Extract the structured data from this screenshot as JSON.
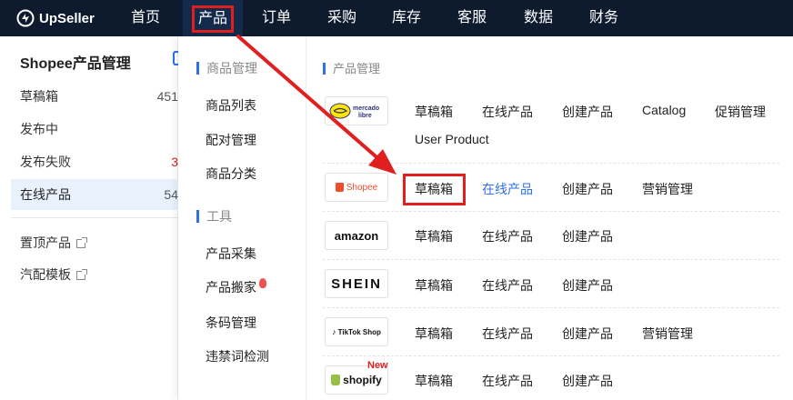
{
  "brand": {
    "name": "UpSeller"
  },
  "topnav": {
    "items": [
      "首页",
      "产品",
      "订单",
      "采购",
      "库存",
      "客服",
      "数据",
      "财务"
    ],
    "active_index": 1
  },
  "sidebar": {
    "title": "Shopee产品管理",
    "items": [
      {
        "label": "草稿箱",
        "count": "451"
      },
      {
        "label": "发布中",
        "count": ""
      },
      {
        "label": "发布失败",
        "count": "3"
      },
      {
        "label": "在线产品",
        "count": "54"
      }
    ],
    "links": [
      {
        "label": "置顶产品"
      },
      {
        "label": "汽配模板"
      }
    ]
  },
  "dropdown": {
    "sections": [
      {
        "title": "商品管理",
        "items": [
          "商品列表",
          "配对管理",
          "商品分类"
        ]
      },
      {
        "title": "工具",
        "items": [
          "产品采集",
          "产品搬家",
          "条码管理",
          "违禁词检测"
        ]
      }
    ],
    "right_section_title": "产品管理",
    "platforms": [
      {
        "logo": "mercado libre",
        "links": [
          "草稿箱",
          "在线产品",
          "创建产品",
          "Catalog",
          "促销管理",
          "User Product"
        ]
      },
      {
        "logo": "Shopee",
        "links": [
          "草稿箱",
          "在线产品",
          "创建产品",
          "营销管理"
        ]
      },
      {
        "logo": "amazon",
        "links": [
          "草稿箱",
          "在线产品",
          "创建产品"
        ]
      },
      {
        "logo": "SHEIN",
        "links": [
          "草稿箱",
          "在线产品",
          "创建产品"
        ]
      },
      {
        "logo": "TikTok Shop",
        "links": [
          "草稿箱",
          "在线产品",
          "创建产品",
          "营销管理"
        ]
      },
      {
        "logo": "shopify",
        "badge": "New",
        "links": [
          "草稿箱",
          "在线产品",
          "创建产品"
        ]
      }
    ]
  },
  "colors": {
    "nav_bg": "#0e1b2e",
    "accent": "#2f6fe8",
    "highlight": "#e02020"
  }
}
